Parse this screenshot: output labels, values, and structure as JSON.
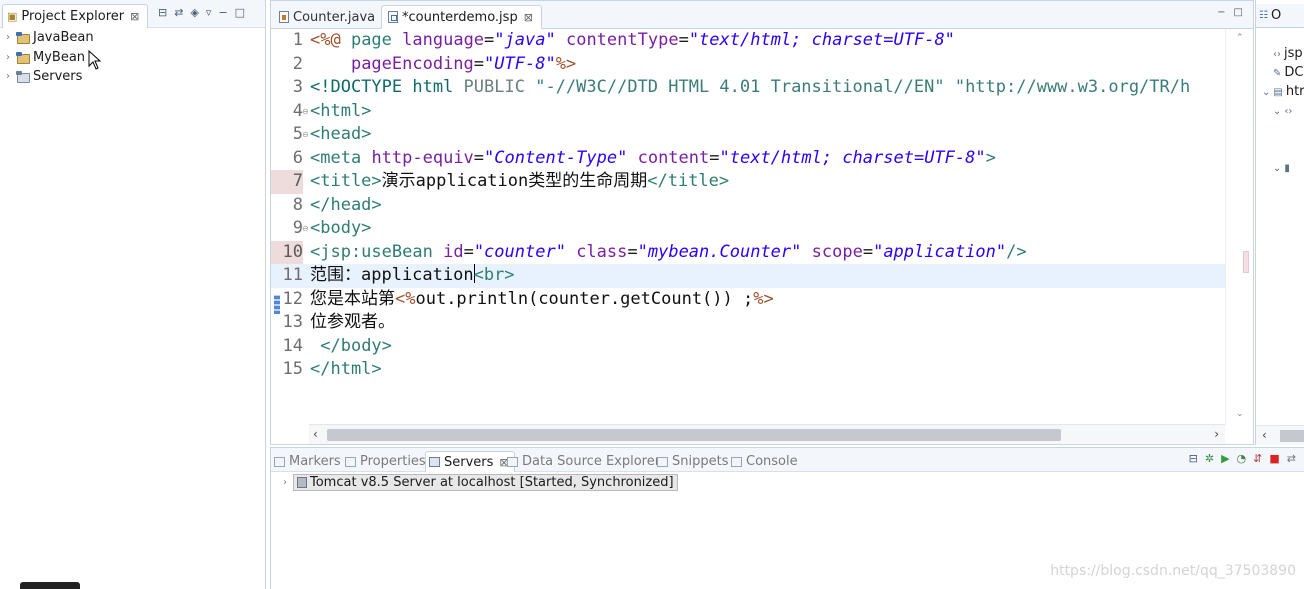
{
  "project_explorer": {
    "tab_label": "Project Explorer",
    "close_glyph": "⊠",
    "items": [
      {
        "label": "JavaBean"
      },
      {
        "label": "MyBean"
      },
      {
        "label": "Servers"
      }
    ]
  },
  "editor": {
    "tabs": [
      {
        "label": "Counter.java",
        "active": false
      },
      {
        "label": "*counterdemo.jsp",
        "active": true
      }
    ],
    "close_glyph": "⊠",
    "current_line": 11,
    "lines": [
      {
        "n": "1",
        "t": "<%@ page language=\"java\" contentType=\"text/html; charset=UTF-8\""
      },
      {
        "n": "2",
        "t": "    pageEncoding=\"UTF-8\"%>"
      },
      {
        "n": "3",
        "t": "<!DOCTYPE html PUBLIC \"-//W3C//DTD HTML 4.01 Transitional//EN\" \"http://www.w3.org/TR/h"
      },
      {
        "n": "4",
        "t": "<html>"
      },
      {
        "n": "5",
        "t": "<head>"
      },
      {
        "n": "6",
        "t": "<meta http-equiv=\"Content-Type\" content=\"text/html; charset=UTF-8\">"
      },
      {
        "n": "7",
        "t": "<title>演示application类型的生命周期</title>"
      },
      {
        "n": "8",
        "t": "</head>"
      },
      {
        "n": "9",
        "t": "<body>"
      },
      {
        "n": "10",
        "t": "<jsp:useBean id=\"counter\" class=\"mybean.Counter\" scope=\"application\"/>"
      },
      {
        "n": "11",
        "t": "范围：application<br>"
      },
      {
        "n": "12",
        "t": "您是本站第<%out.println(counter.getCount()) ;%>"
      },
      {
        "n": "13",
        "t": "位参观者。"
      },
      {
        "n": "14",
        "t": " </body>"
      },
      {
        "n": "15",
        "t": "</html>"
      }
    ]
  },
  "outline": {
    "tab_label": "O",
    "rows": [
      "jsp",
      "DC",
      "htr"
    ]
  },
  "bottom_panel": {
    "tabs": [
      {
        "label": "Markers",
        "active": false
      },
      {
        "label": "Properties",
        "active": false
      },
      {
        "label": "Servers",
        "active": true
      },
      {
        "label": "Data Source Explorer",
        "active": false
      },
      {
        "label": "Snippets",
        "active": false
      },
      {
        "label": "Console",
        "active": false
      }
    ],
    "close_glyph": "⊠",
    "server_entry": "Tomcat v8.5 Server at localhost  [Started, Synchronized]"
  },
  "watermark": "https://blog.csdn.net/qq_37503890",
  "colors": {
    "accent": "#3b6fb6",
    "current_line": "#e8f2fe",
    "tag": "#2e7d73",
    "attribute": "#7a1fa2",
    "value": "#2a00ff",
    "directive": "#a0522d"
  },
  "icons": {
    "project": "project-folder-icon",
    "server": "server-icon",
    "file_java": "java-file-icon",
    "file_jsp": "jsp-file-icon"
  }
}
